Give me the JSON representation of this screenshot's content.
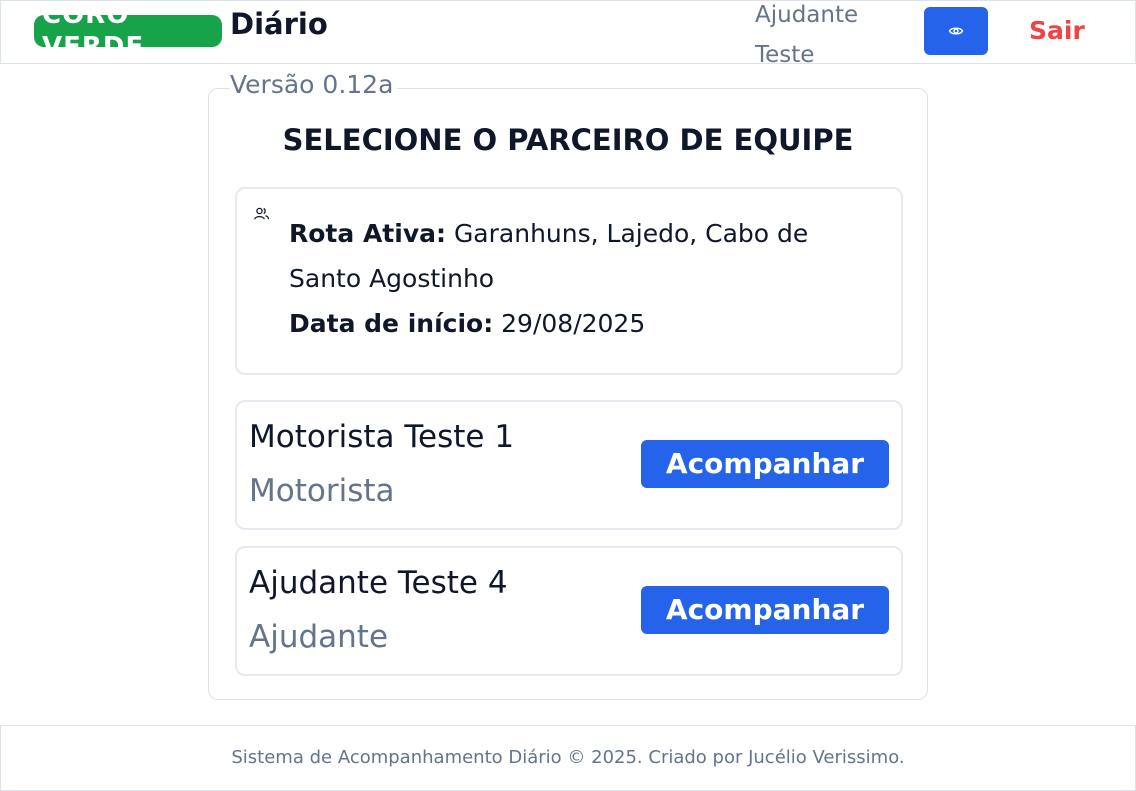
{
  "header": {
    "logo_text": "CORO VERDE",
    "title": "Diário",
    "version": "Versão 0.12a",
    "user_name": "Ajudante Teste",
    "view_icon": "eye-icon",
    "logout_label": "Sair"
  },
  "card": {
    "title": "SELECIONE O PARCEIRO DE EQUIPE",
    "route": {
      "icon": "users-icon",
      "route_label": "Rota Ativa:",
      "route_value": "Garanhuns, Lajedo, Cabo de Santo Agostinho",
      "start_label": "Data de início:",
      "start_value": "29/08/2025"
    },
    "members": [
      {
        "name": "Motorista Teste 1",
        "role": "Motorista",
        "action": "Acompanhar"
      },
      {
        "name": "Ajudante Teste 4",
        "role": "Ajudante",
        "action": "Acompanhar"
      }
    ]
  },
  "footer": {
    "text": "Sistema de Acompanhamento Diário © 2025. Criado por Jucélio Verissimo."
  },
  "colors": {
    "primary": "#2563eb",
    "brand": "#16a34a",
    "danger": "#ef4444",
    "muted": "#64748b"
  }
}
